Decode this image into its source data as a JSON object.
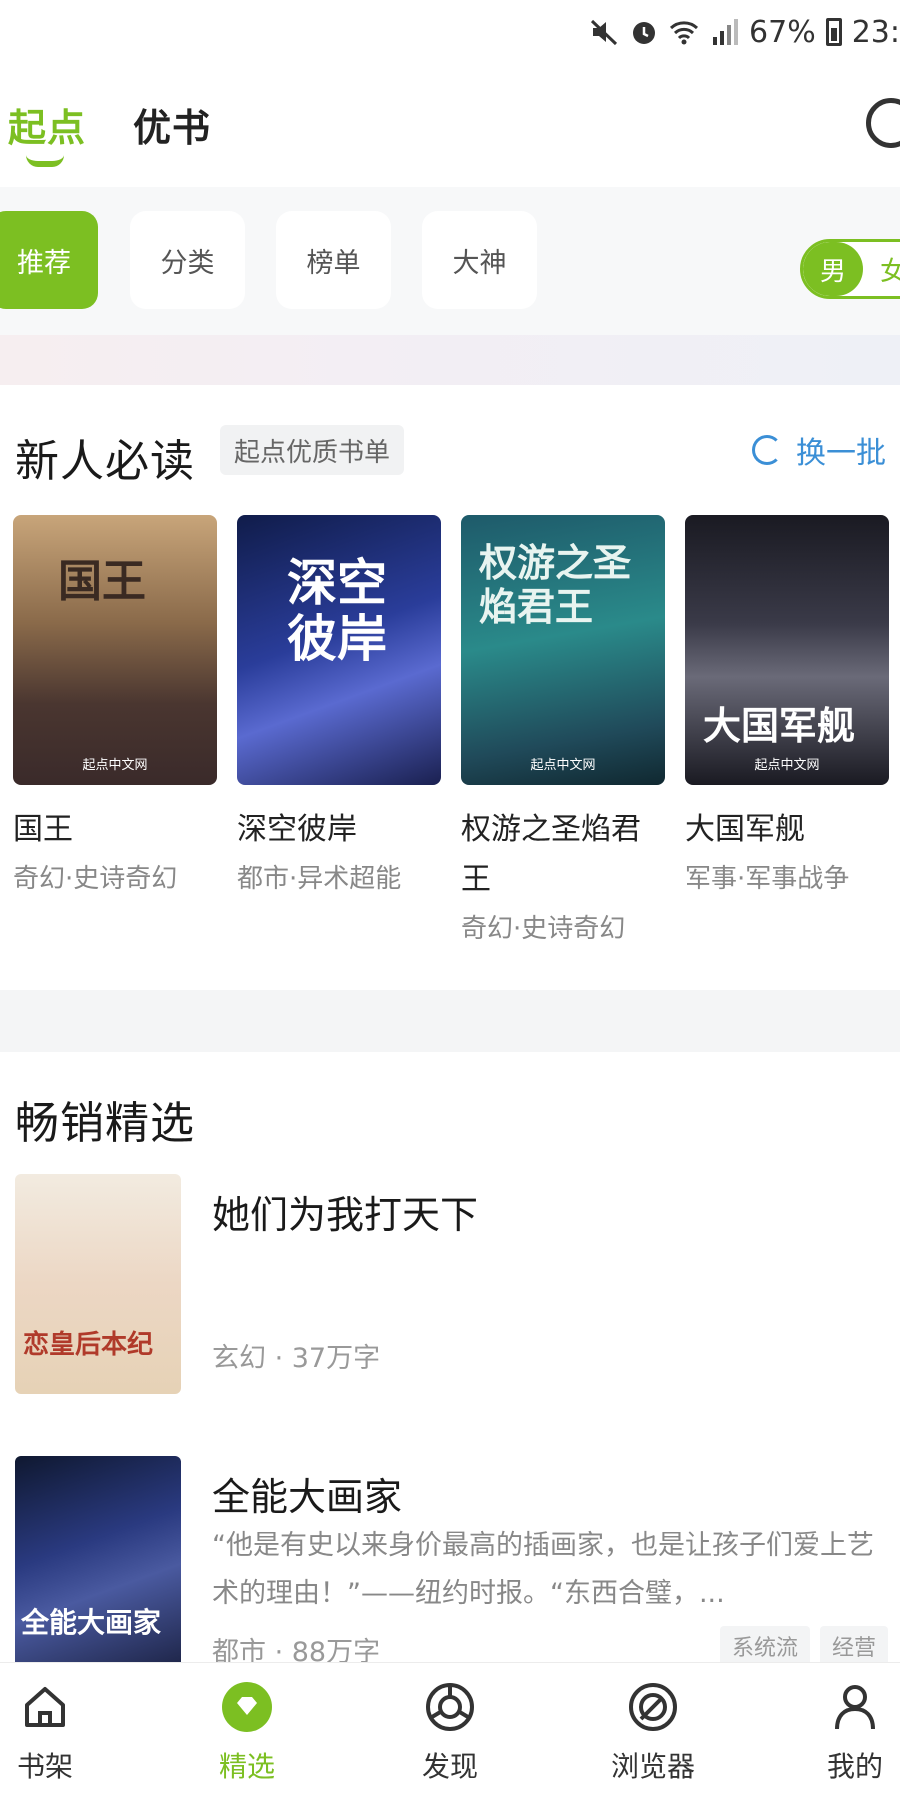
{
  "status_bar": {
    "battery": "67%",
    "time": "23:"
  },
  "top_tabs": [
    {
      "label": "起点"
    },
    {
      "label": "优书"
    }
  ],
  "chips": [
    {
      "label": "推荐"
    },
    {
      "label": "分类"
    },
    {
      "label": "榜单"
    },
    {
      "label": "大神"
    }
  ],
  "gender": {
    "male": "男",
    "female": "女"
  },
  "newbie": {
    "title": "新人必读",
    "tag": "起点优质书单",
    "refresh": "换一批",
    "books": [
      {
        "name": "国王",
        "genre": "奇幻·史诗奇幻",
        "cover_text": "国王",
        "brand": "起点中文网"
      },
      {
        "name": "深空彼岸",
        "genre": "都市·异术超能",
        "cover_text": "深空彼岸",
        "brand": ""
      },
      {
        "name": "权游之圣焰君王",
        "genre": "奇幻·史诗奇幻",
        "cover_text": "权游之圣焰君王",
        "brand": "起点中文网"
      },
      {
        "name": "大国军舰",
        "genre": "军事·军事战争",
        "cover_text": "大国军舰",
        "brand": "起点中文网"
      }
    ]
  },
  "bestseller": {
    "title": "畅销精选",
    "items": [
      {
        "title": "她们为我打天下",
        "desc": "",
        "meta": "玄幻 · 37万字",
        "cover_text": "恋皇后本纪",
        "tags": []
      },
      {
        "title": "全能大画家",
        "desc": "“他是有史以来身价最高的插画家，也是让孩子们爱上艺术的理由！”——纽约时报。“东西合璧，...",
        "meta": "都市 · 88万字",
        "cover_text": "全能大画家",
        "tags": [
          "系统流",
          "经营"
        ]
      }
    ]
  },
  "bottom_nav": [
    {
      "label": "书架",
      "icon": "home-icon"
    },
    {
      "label": "精选",
      "icon": "diamond-icon"
    },
    {
      "label": "发现",
      "icon": "compass-icon"
    },
    {
      "label": "浏览器",
      "icon": "browser-icon"
    },
    {
      "label": "我的",
      "icon": "user-icon"
    }
  ],
  "colors": {
    "accent": "#7cbf22",
    "link": "#3b8fd6"
  }
}
